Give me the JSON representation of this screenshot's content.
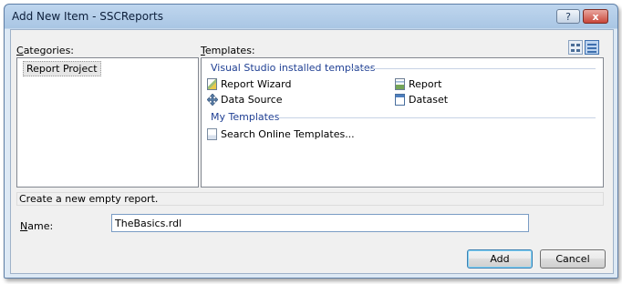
{
  "window": {
    "title": "Add New Item - SSCReports",
    "help_label": "?",
    "close_label": "x"
  },
  "categories": {
    "label": "Categories:",
    "items": [
      {
        "label": "Report Project",
        "selected": true
      }
    ]
  },
  "templates": {
    "label": "Templates:",
    "view_large_icons": "large-icons-view-icon",
    "view_small_icons": "small-icons-view-icon",
    "groups": [
      {
        "label": "Visual Studio installed templates",
        "items": [
          {
            "label": "Report Wizard",
            "icon": "report-wizard-icon"
          },
          {
            "label": "Report",
            "icon": "report-icon"
          },
          {
            "label": "Data Source",
            "icon": "data-source-icon"
          },
          {
            "label": "Dataset",
            "icon": "dataset-icon"
          }
        ]
      },
      {
        "label": "My Templates",
        "items": [
          {
            "label": "Search Online Templates...",
            "icon": "search-online-icon"
          }
        ]
      }
    ]
  },
  "description": "Create a new empty report.",
  "name_field": {
    "label": "Name:",
    "value": "TheBasics.rdl"
  },
  "buttons": {
    "add": "Add",
    "cancel": "Cancel"
  },
  "colors": {
    "group_header": "#1f3f93",
    "titlebar": "#a9c6e4"
  }
}
